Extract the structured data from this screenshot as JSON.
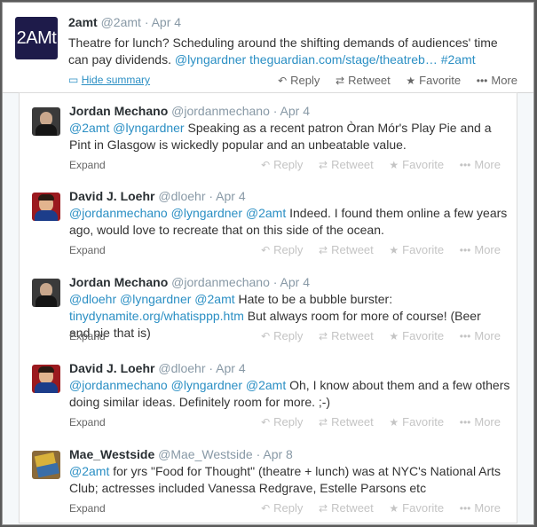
{
  "actions": {
    "reply": "Reply",
    "retweet": "Retweet",
    "favorite": "Favorite",
    "more": "More"
  },
  "expand_label": "Expand",
  "main": {
    "avatar_text": "2AMt",
    "name": "2amt",
    "handle": "@2amt",
    "time": "Apr 4",
    "text_1": "Theatre for lunch? Scheduling around the shifting demands of audiences' time can pay dividends.",
    "link_1": "@lyngardner",
    "link_2": "theguardian.com/stage/theatreb…",
    "link_3": "#2amt",
    "summary": "Hide summary"
  },
  "replies": [
    {
      "name": "Jordan Mechano",
      "handle": "@jordanmechano",
      "time": "Apr 4",
      "m1": "@2amt",
      "m2": "@lyngardner",
      "body": "Speaking as a recent patron Òran Mór's Play Pie and a Pint in Glasgow is wickedly popular and an unbeatable value."
    },
    {
      "name": "David J. Loehr",
      "handle": "@dloehr",
      "time": "Apr 4",
      "m1": "@jordanmechano",
      "m2": "@lyngardner",
      "m3": "@2amt",
      "body": "Indeed. I found them online a few years ago, would love to recreate that on this side of the ocean."
    },
    {
      "name": "Jordan Mechano",
      "handle": "@jordanmechano",
      "time": "Apr 4",
      "m1": "@dloehr",
      "m2": "@lyngardner",
      "m3": "@2amt",
      "body_a": "Hate to be a bubble burster:",
      "url": "tinydynamite.org/whatisppp.htm",
      "body_b": "But always room for more of course! (Beer and pie that is)"
    },
    {
      "name": "David J. Loehr",
      "handle": "@dloehr",
      "time": "Apr 4",
      "m1": "@jordanmechano",
      "m2": "@lyngardner",
      "m3": "@2amt",
      "body": "Oh, I know about them and a few others doing similar ideas. Definitely room for more. ;-)"
    },
    {
      "name": "Mae_Westside",
      "handle": "@Mae_Westside",
      "time": "Apr 8",
      "m1": "@2amt",
      "body": "for yrs \"Food for Thought\" (theatre + lunch) was at NYC's National Arts Club; actresses included Vanessa Redgrave, Estelle Parsons etc"
    }
  ]
}
